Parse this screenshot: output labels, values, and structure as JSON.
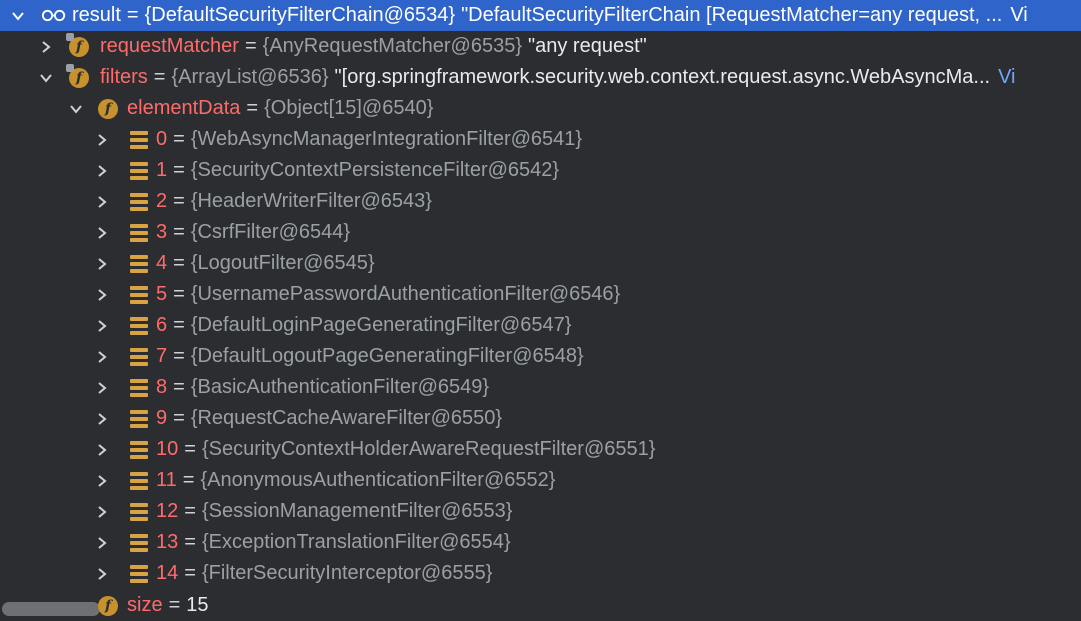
{
  "root": {
    "name": "result",
    "value": "{DefaultSecurityFilterChain@6534}",
    "preview": "\"DefaultSecurityFilterChain [RequestMatcher=any request, ...",
    "link": "Vi"
  },
  "request_matcher": {
    "name": "requestMatcher",
    "value": "{AnyRequestMatcher@6535}",
    "preview": "\"any request\""
  },
  "filters": {
    "name": "filters",
    "value": "{ArrayList@6536}",
    "preview": "\"[org.springframework.security.web.context.request.async.WebAsyncMa...",
    "link": "Vi"
  },
  "element_data": {
    "name": "elementData",
    "value": "{Object[15]@6540}"
  },
  "items": [
    {
      "index": "0",
      "value": "{WebAsyncManagerIntegrationFilter@6541}"
    },
    {
      "index": "1",
      "value": "{SecurityContextPersistenceFilter@6542}"
    },
    {
      "index": "2",
      "value": "{HeaderWriterFilter@6543}"
    },
    {
      "index": "3",
      "value": "{CsrfFilter@6544}"
    },
    {
      "index": "4",
      "value": "{LogoutFilter@6545}"
    },
    {
      "index": "5",
      "value": "{UsernamePasswordAuthenticationFilter@6546}"
    },
    {
      "index": "6",
      "value": "{DefaultLoginPageGeneratingFilter@6547}"
    },
    {
      "index": "7",
      "value": "{DefaultLogoutPageGeneratingFilter@6548}"
    },
    {
      "index": "8",
      "value": "{BasicAuthenticationFilter@6549}"
    },
    {
      "index": "9",
      "value": "{RequestCacheAwareFilter@6550}"
    },
    {
      "index": "10",
      "value": "{SecurityContextHolderAwareRequestFilter@6551}"
    },
    {
      "index": "11",
      "value": "{AnonymousAuthenticationFilter@6552}"
    },
    {
      "index": "12",
      "value": "{SessionManagementFilter@6553}"
    },
    {
      "index": "13",
      "value": "{ExceptionTranslationFilter@6554}"
    },
    {
      "index": "14",
      "value": "{FilterSecurityInterceptor@6555}"
    }
  ],
  "size": {
    "name": "size",
    "value": "15"
  },
  "eq": "=",
  "colors": {
    "background": "#2b2d30",
    "selection": "#2f65ca",
    "field_name": "#ff6b6b",
    "object_ref": "#9aa0a6",
    "badge": "#c7912e",
    "list_icon": "#d9a343",
    "link": "#6fa8ff"
  },
  "icons": {
    "root": "watch-glasses-icon",
    "field": "field-f-icon",
    "element": "array-element-icon",
    "expand": "chevron-right-icon",
    "collapse": "chevron-down-icon"
  }
}
